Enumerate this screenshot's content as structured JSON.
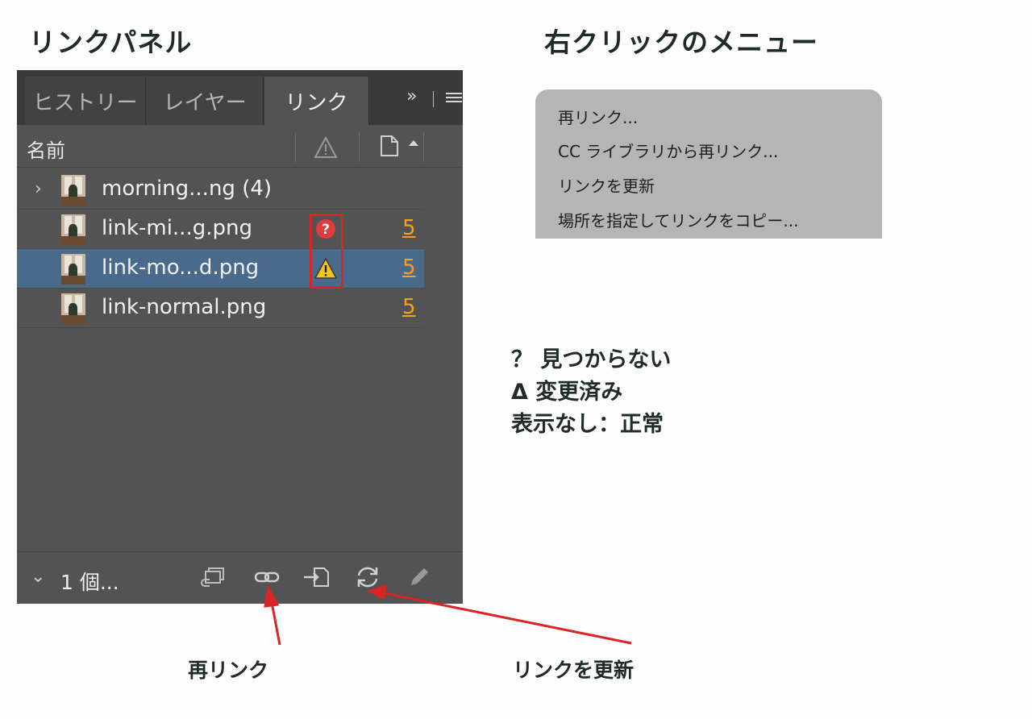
{
  "headings": {
    "left": "リンクパネル",
    "right": "右クリックのメニュー"
  },
  "panel": {
    "tabs": [
      {
        "label": "ヒストリー",
        "active": false
      },
      {
        "label": "レイヤー",
        "active": false
      },
      {
        "label": "リンク",
        "active": true
      }
    ],
    "tab_overflow": "»",
    "column_header": {
      "name": "名前"
    },
    "rows": [
      {
        "name": "morning...ng (4)",
        "expandable": true,
        "status": "",
        "page": ""
      },
      {
        "name": "link-mi...g.png",
        "expandable": false,
        "status": "missing",
        "page": "5"
      },
      {
        "name": "link-mo...d.png",
        "expandable": false,
        "status": "modified",
        "page": "5",
        "selected": true
      },
      {
        "name": "link-normal.png",
        "expandable": false,
        "status": "normal",
        "page": "5"
      }
    ],
    "footer": {
      "count": "1 個...",
      "icons": [
        "cc-library-link-icon",
        "relink-icon",
        "go-to-link-icon",
        "update-link-icon",
        "edit-original-icon"
      ]
    }
  },
  "context_menu": {
    "items": [
      "再リンク...",
      "CC ライブラリから再リンク...",
      "リンクを更新",
      "場所を指定してリンクをコピー..."
    ]
  },
  "legend": [
    "？ 見つからない",
    "Δ 変更済み",
    "表示なし：正常"
  ],
  "captions": {
    "relink": "再リンク",
    "update": "リンクを更新"
  },
  "colors": {
    "accent_page": "#f5a01f",
    "selected_row": "#4a6a8b",
    "annotation_red": "#d92525"
  }
}
